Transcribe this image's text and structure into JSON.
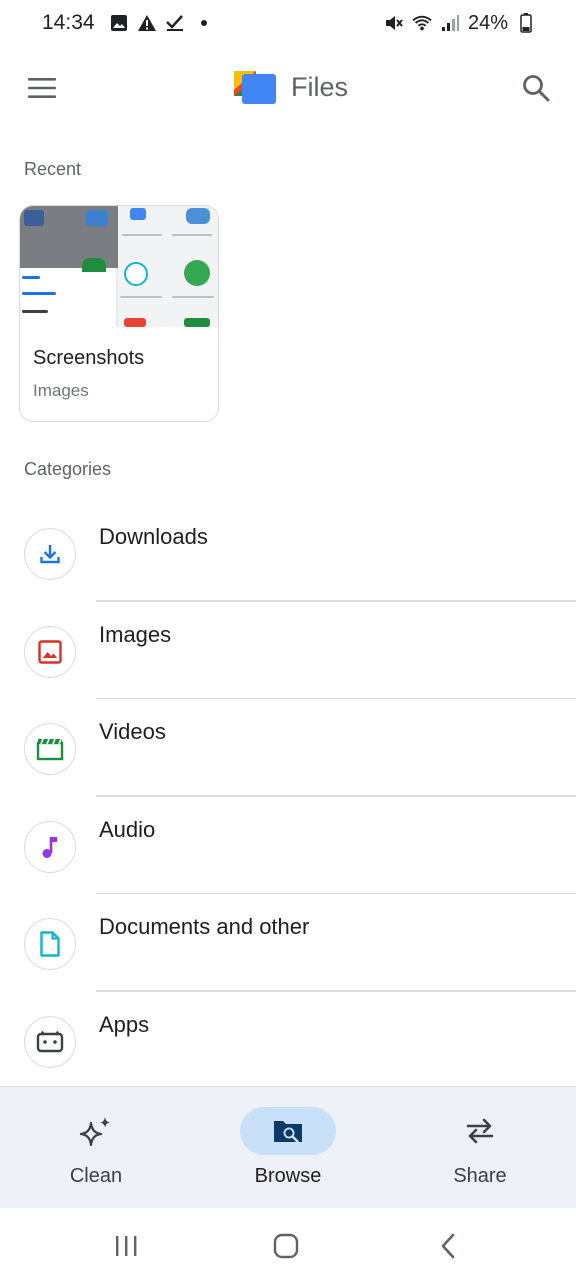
{
  "status_bar": {
    "time": "14:34",
    "battery": "24%",
    "left_icons": [
      "gallery-icon",
      "warning-icon",
      "check-icon",
      "dot-icon"
    ],
    "right_icons": [
      "mute-icon",
      "wifi-icon",
      "signal-icon",
      "battery-icon"
    ]
  },
  "app_bar": {
    "title": "Files",
    "menu_icon": "menu-icon",
    "search_icon": "search-icon"
  },
  "recent": {
    "heading": "Recent",
    "card": {
      "title": "Screenshots",
      "subtitle": "Images"
    }
  },
  "categories": {
    "heading": "Categories",
    "items": [
      {
        "label": "Downloads",
        "icon": "download-icon",
        "color": "#1a73e8"
      },
      {
        "label": "Images",
        "icon": "image-icon",
        "color": "#d93025"
      },
      {
        "label": "Videos",
        "icon": "video-icon",
        "color": "#1e8e3e"
      },
      {
        "label": "Audio",
        "icon": "audio-icon",
        "color": "#9334e6"
      },
      {
        "label": "Documents and other",
        "icon": "document-icon",
        "color": "#12b5cb"
      },
      {
        "label": "Apps",
        "icon": "apps-icon",
        "color": "#3c4043"
      }
    ]
  },
  "bottom_nav": {
    "items": [
      {
        "label": "Clean",
        "icon": "sparkle-icon",
        "active": false
      },
      {
        "label": "Browse",
        "icon": "browse-folder-icon",
        "active": true
      },
      {
        "label": "Share",
        "icon": "swap-icon",
        "active": false
      }
    ]
  },
  "colors": {
    "accent": "#1a73e8",
    "active_pill": "#c8e0f8",
    "nav_background": "#eef1f8"
  }
}
